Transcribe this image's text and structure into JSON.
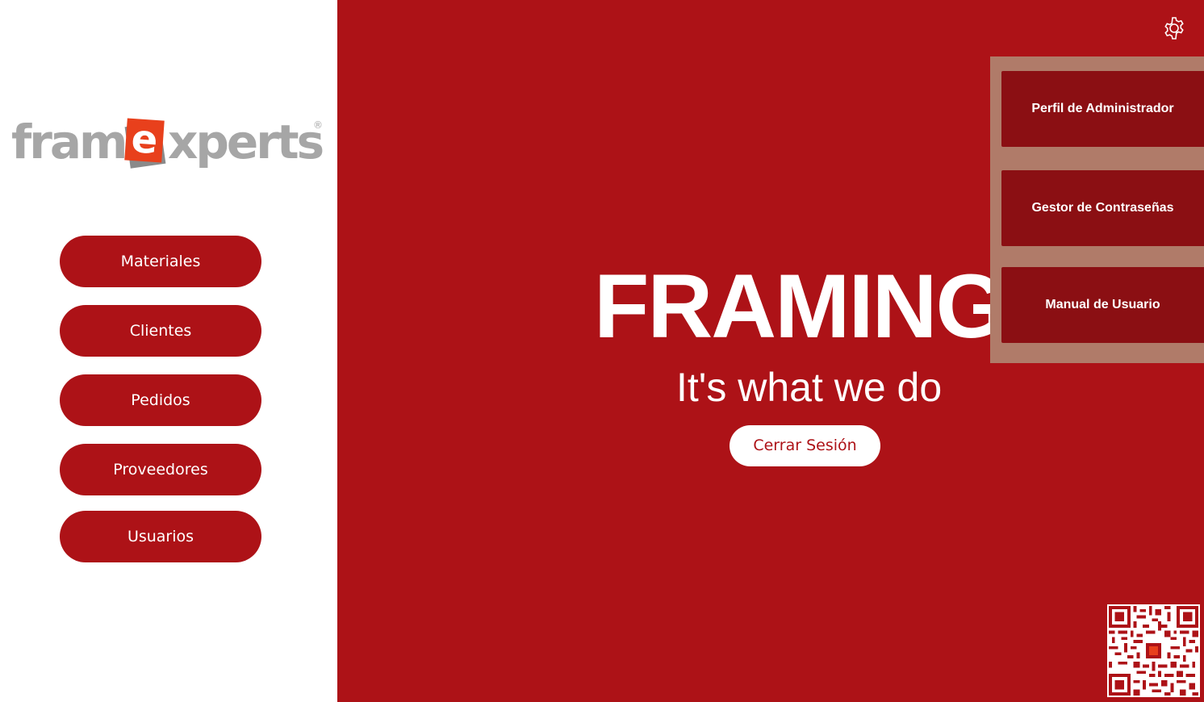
{
  "logo": {
    "part1": "fram",
    "letter": "e",
    "part2": "xperts",
    "registered": "®"
  },
  "sidebar": {
    "items": [
      {
        "label": "Materiales"
      },
      {
        "label": "Clientes"
      },
      {
        "label": "Pedidos"
      },
      {
        "label": "Proveedores"
      },
      {
        "label": "Usuarios"
      }
    ]
  },
  "hero": {
    "title": "FRAMING",
    "subtitle": "It's what we do",
    "logout_label": "Cerrar Sesión"
  },
  "settings_menu": {
    "items": [
      {
        "label": "Perfil de Administrador"
      },
      {
        "label": "Gestor de Contraseñas"
      },
      {
        "label": "Manual de Usuario"
      }
    ]
  },
  "colors": {
    "brand_red": "#ad1217",
    "dark_red": "#8b0f13",
    "menu_backdrop": "#b07b69",
    "logo_grey": "#a6a6a6",
    "logo_orange": "#e8401c"
  },
  "icons": {
    "settings": "gear-icon",
    "qr": "qr-code-icon"
  }
}
